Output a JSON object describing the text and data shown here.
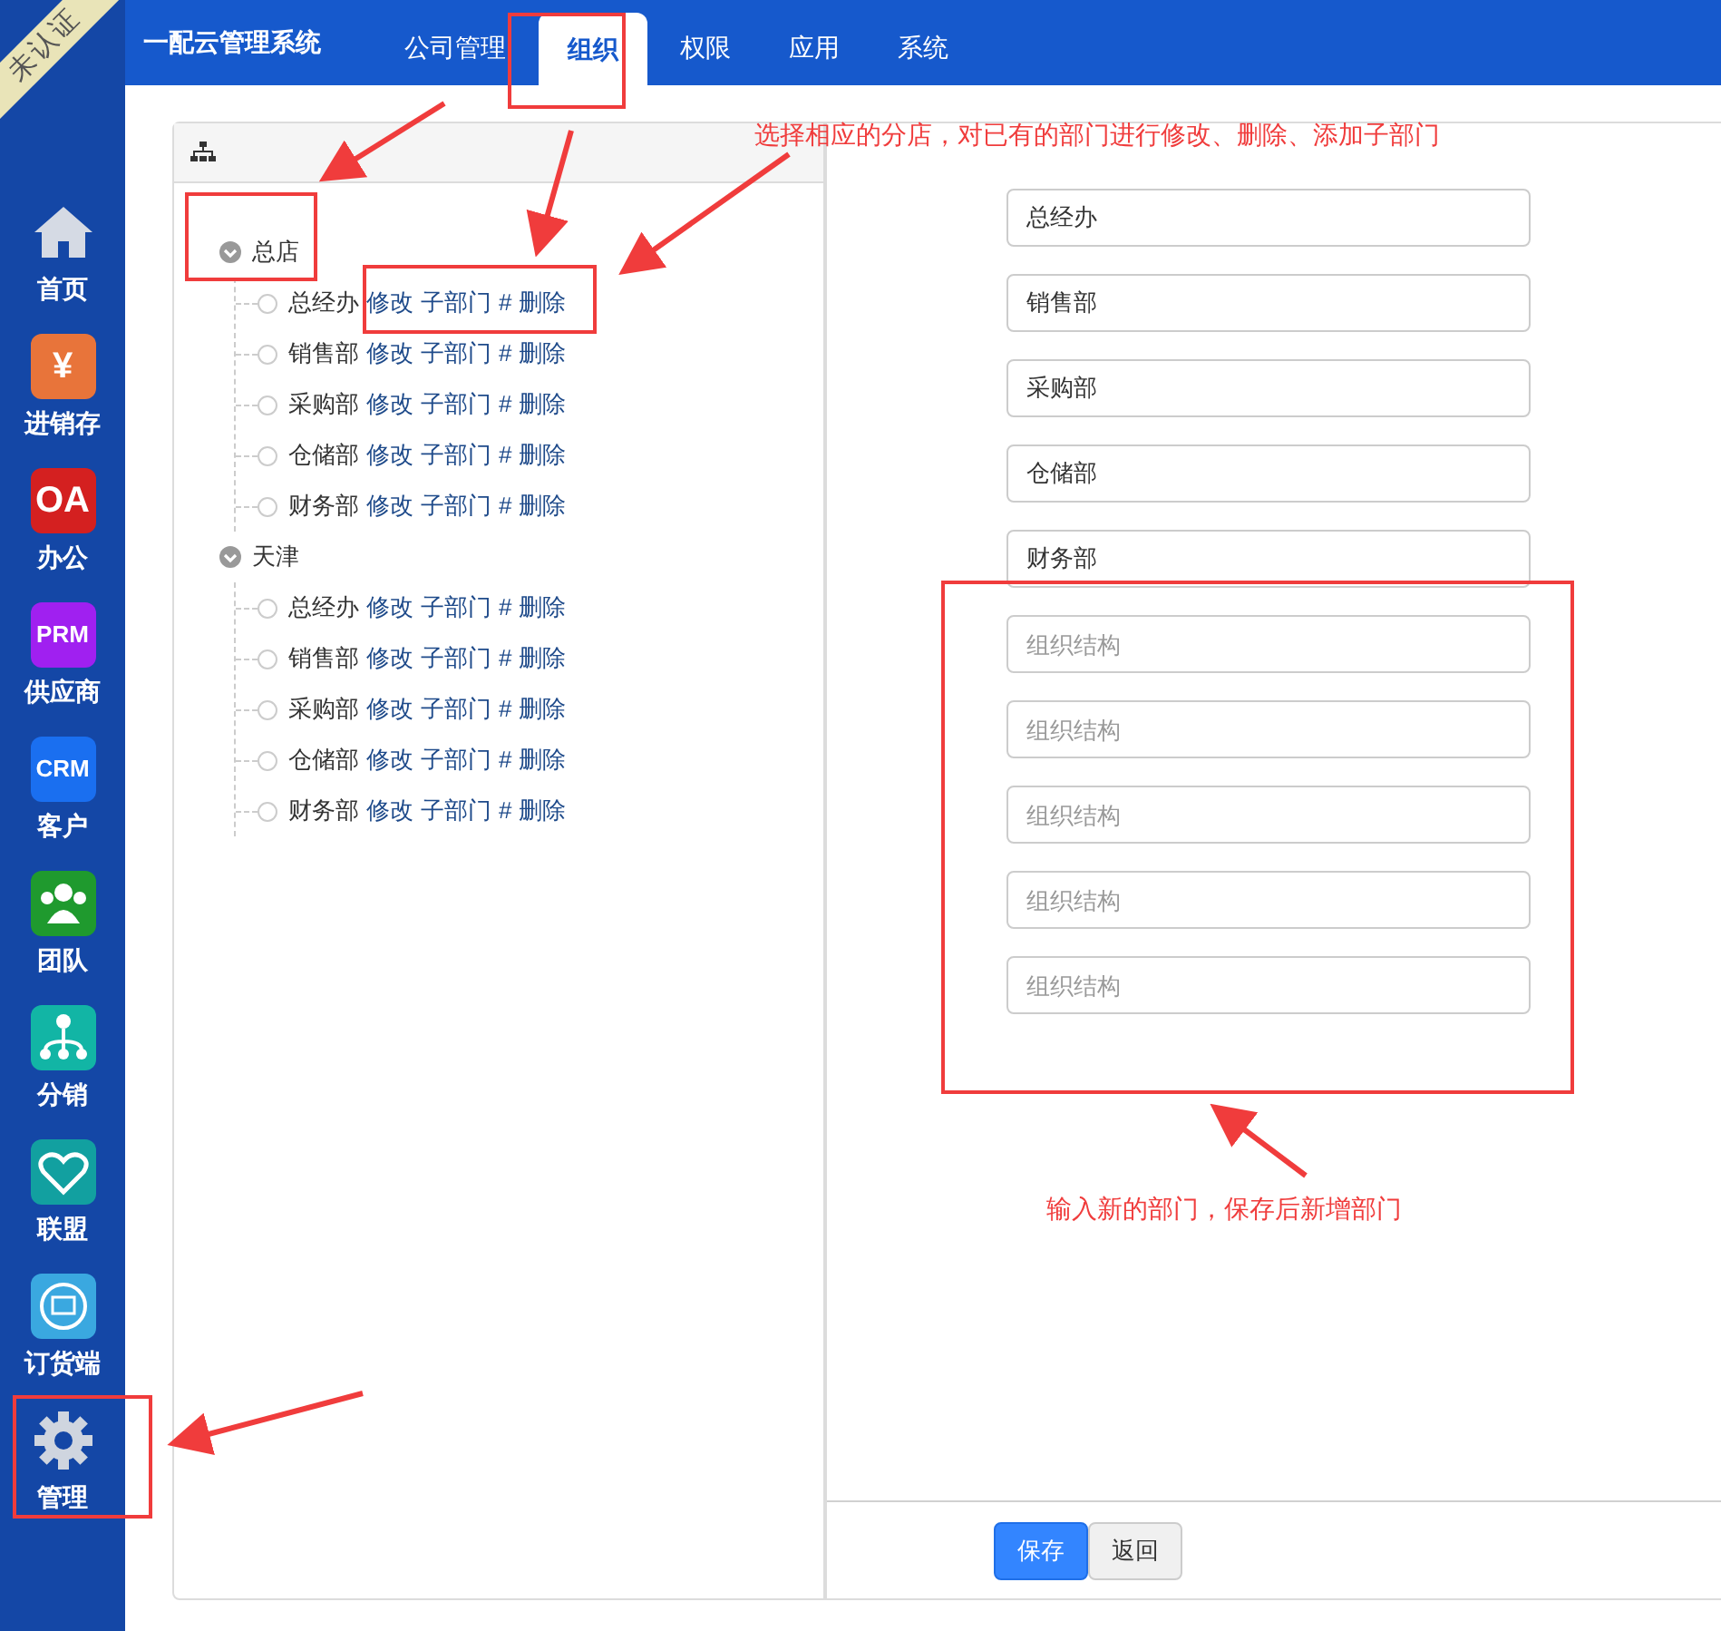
{
  "ribbon": "未认证",
  "sidebar": {
    "items": [
      {
        "label": "首页",
        "kind": "house"
      },
      {
        "label": "进销存",
        "kind": "badge",
        "badge": "¥",
        "color": "#e8743a"
      },
      {
        "label": "办公",
        "kind": "badge",
        "badge": "OA",
        "color": "#d42020"
      },
      {
        "label": "供应商",
        "kind": "badge",
        "badge": "PRM",
        "color": "#a020f0"
      },
      {
        "label": "客户",
        "kind": "badge",
        "badge": "CRM",
        "color": "#1a6ff0"
      },
      {
        "label": "团队",
        "kind": "team",
        "color": "#1f9a2e"
      },
      {
        "label": "分销",
        "kind": "tree",
        "color": "#12b5a5"
      },
      {
        "label": "联盟",
        "kind": "heart",
        "color": "#12a0a0"
      },
      {
        "label": "订货端",
        "kind": "cart",
        "color": "#3aa8e0"
      },
      {
        "label": "管理",
        "kind": "gear"
      }
    ]
  },
  "top_nav": {
    "brand": "一配云管理系统",
    "tabs": [
      {
        "label": "公司管理",
        "selected": false
      },
      {
        "label": "组织",
        "selected": true
      },
      {
        "label": "权限",
        "selected": false
      },
      {
        "label": "应用",
        "selected": false
      },
      {
        "label": "系统",
        "selected": false
      }
    ]
  },
  "tree": {
    "nodes": [
      {
        "label": "总店",
        "expanded": true,
        "children": [
          {
            "label": "总经办",
            "actions": [
              "修改",
              "子部门",
              "#",
              "删除"
            ]
          },
          {
            "label": "销售部",
            "actions": [
              "修改",
              "子部门",
              "#",
              "删除"
            ]
          },
          {
            "label": "采购部",
            "actions": [
              "修改",
              "子部门",
              "#",
              "删除"
            ]
          },
          {
            "label": "仓储部",
            "actions": [
              "修改",
              "子部门",
              "#",
              "删除"
            ]
          },
          {
            "label": "财务部",
            "actions": [
              "修改",
              "子部门",
              "#",
              "删除"
            ]
          }
        ]
      },
      {
        "label": "天津",
        "expanded": true,
        "children": [
          {
            "label": "总经办",
            "actions": [
              "修改",
              "子部门",
              "#",
              "删除"
            ]
          },
          {
            "label": "销售部",
            "actions": [
              "修改",
              "子部门",
              "#",
              "删除"
            ]
          },
          {
            "label": "采购部",
            "actions": [
              "修改",
              "子部门",
              "#",
              "删除"
            ]
          },
          {
            "label": "仓储部",
            "actions": [
              "修改",
              "子部门",
              "#",
              "删除"
            ]
          },
          {
            "label": "财务部",
            "actions": [
              "修改",
              "子部门",
              "#",
              "删除"
            ]
          }
        ]
      }
    ]
  },
  "form": {
    "fields": [
      {
        "value": "总经办"
      },
      {
        "value": "销售部"
      },
      {
        "value": "采购部"
      },
      {
        "value": "仓储部"
      },
      {
        "value": "财务部"
      },
      {
        "placeholder": "组织结构"
      },
      {
        "placeholder": "组织结构"
      },
      {
        "placeholder": "组织结构"
      },
      {
        "placeholder": "组织结构"
      },
      {
        "placeholder": "组织结构"
      }
    ],
    "buttons": [
      {
        "label": "保存",
        "kind": "primary"
      },
      {
        "label": "返回",
        "kind": "default"
      }
    ]
  },
  "annotations": {
    "notes": [
      "选择相应的分店，对已有的部门进行修改、删除、添加子部门",
      "输入新的部门，保存后新增部门"
    ]
  }
}
